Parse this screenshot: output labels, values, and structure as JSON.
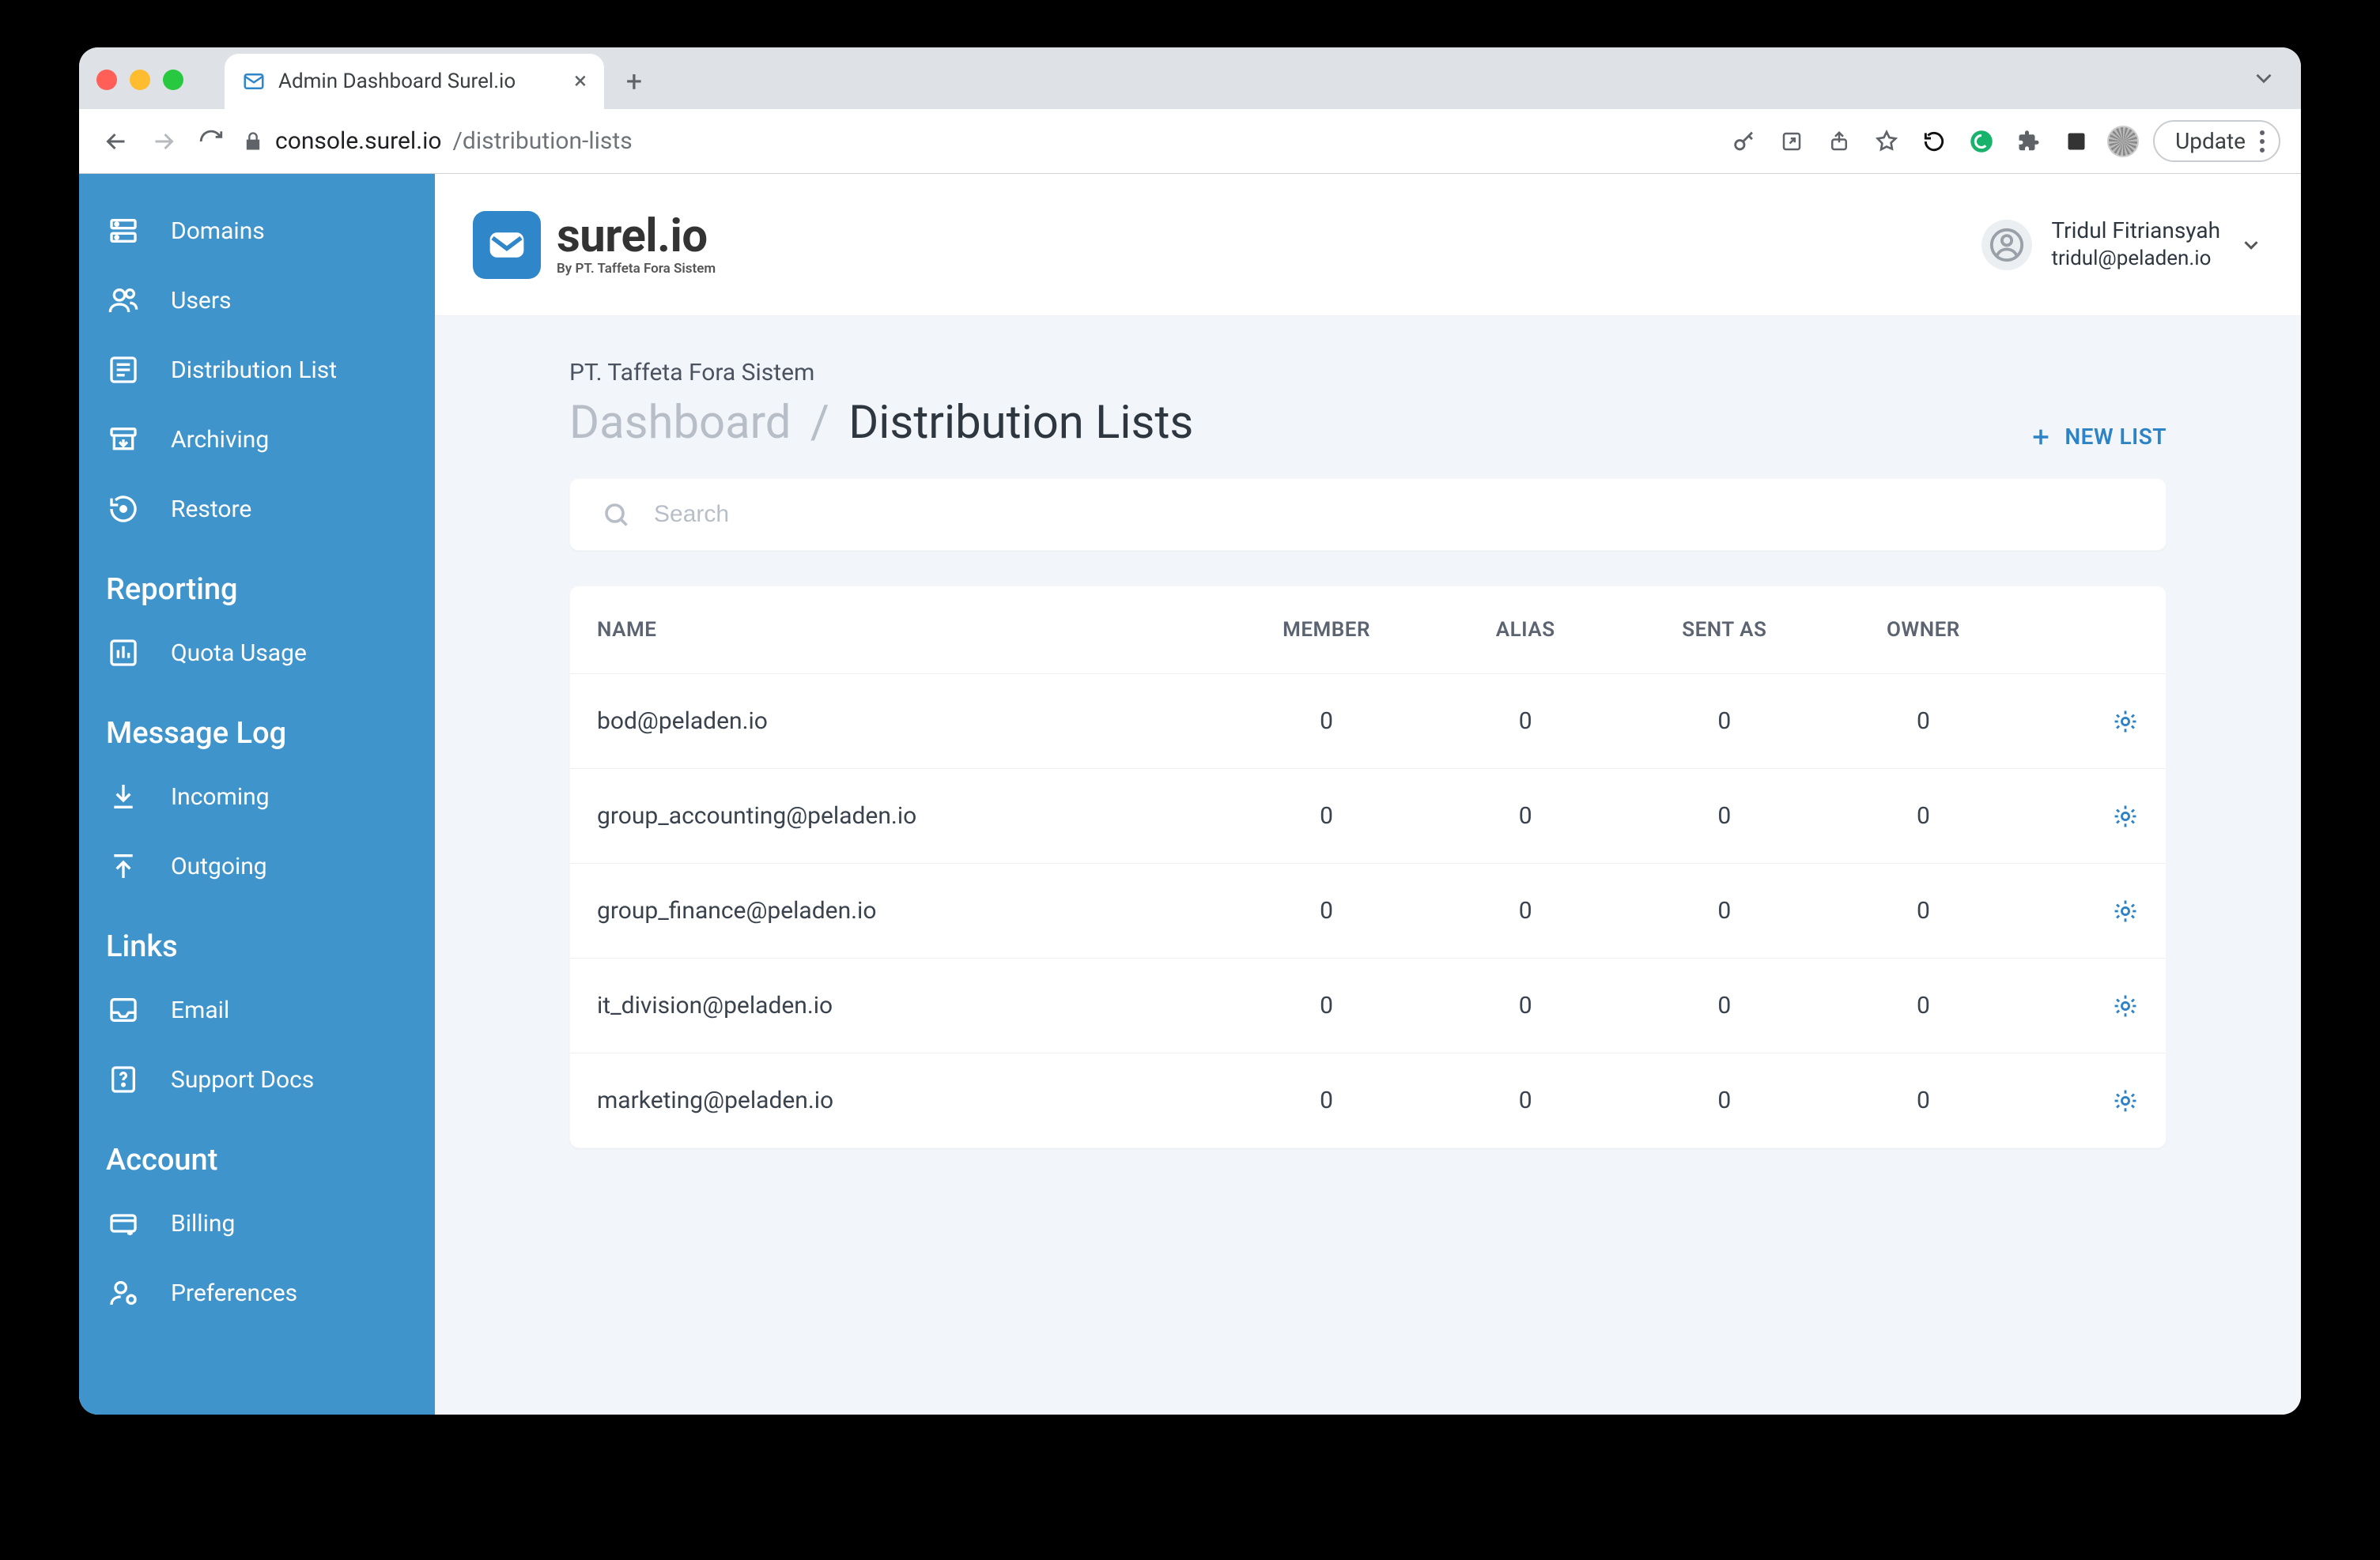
{
  "browser": {
    "tab_title": "Admin Dashboard Surel.io",
    "url_host": "console.surel.io",
    "url_path": "/distribution-lists",
    "update_label": "Update"
  },
  "sidebar": {
    "items": [
      {
        "label": "Domains"
      },
      {
        "label": "Users"
      },
      {
        "label": "Distribution List"
      },
      {
        "label": "Archiving"
      },
      {
        "label": "Restore"
      }
    ],
    "section_reporting": "Reporting",
    "reporting_items": [
      {
        "label": "Quota Usage"
      }
    ],
    "section_messagelog": "Message Log",
    "messagelog_items": [
      {
        "label": "Incoming"
      },
      {
        "label": "Outgoing"
      }
    ],
    "section_links": "Links",
    "links_items": [
      {
        "label": "Email"
      },
      {
        "label": "Support Docs"
      }
    ],
    "section_account": "Account",
    "account_items": [
      {
        "label": "Billing"
      },
      {
        "label": "Preferences"
      }
    ]
  },
  "brand": {
    "name": "surel.io",
    "byline": "By PT. Taffeta Fora Sistem"
  },
  "user": {
    "name": "Tridul Fitriansyah",
    "email": "tridul@peladen.io"
  },
  "page": {
    "org": "PT. Taffeta Fora Sistem",
    "crumb_root": "Dashboard",
    "crumb_current": "Distribution Lists",
    "new_list_label": "NEW LIST",
    "search_placeholder": "Search"
  },
  "table": {
    "headers": {
      "name": "NAME",
      "member": "MEMBER",
      "alias": "ALIAS",
      "sent_as": "SENT AS",
      "owner": "OWNER"
    },
    "rows": [
      {
        "name": "bod@peladen.io",
        "member": "0",
        "alias": "0",
        "sent_as": "0",
        "owner": "0"
      },
      {
        "name": "group_accounting@peladen.io",
        "member": "0",
        "alias": "0",
        "sent_as": "0",
        "owner": "0"
      },
      {
        "name": "group_finance@peladen.io",
        "member": "0",
        "alias": "0",
        "sent_as": "0",
        "owner": "0"
      },
      {
        "name": "it_division@peladen.io",
        "member": "0",
        "alias": "0",
        "sent_as": "0",
        "owner": "0"
      },
      {
        "name": "marketing@peladen.io",
        "member": "0",
        "alias": "0",
        "sent_as": "0",
        "owner": "0"
      }
    ]
  }
}
